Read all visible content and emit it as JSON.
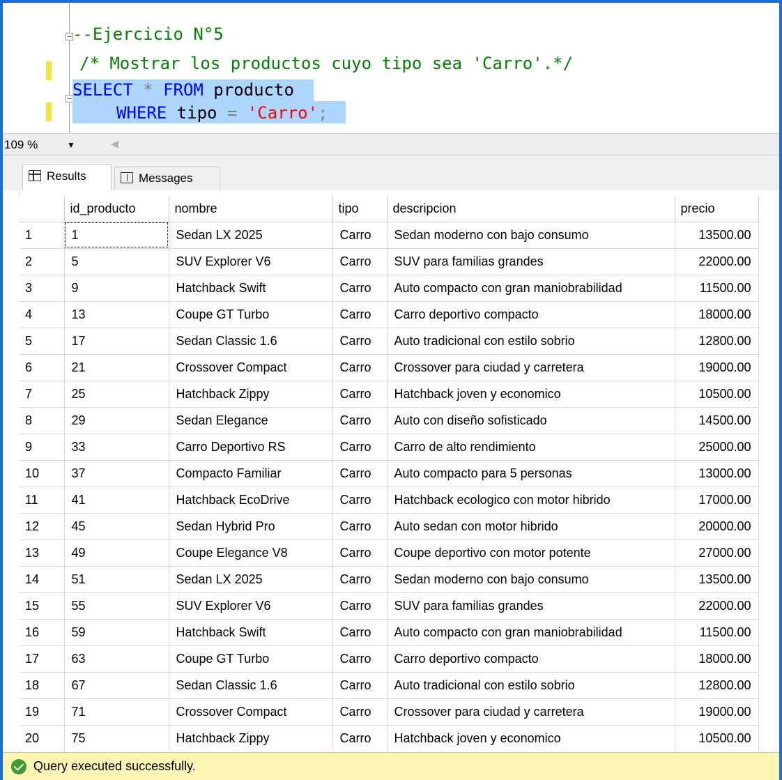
{
  "editor": {
    "lines": [
      {
        "comment": "--Ejercicio N°5"
      },
      {
        "comment": "/* Mostrar los productos cuyo tipo sea 'Carro'.*/"
      },
      {
        "kw1": "SELECT",
        "op": " * ",
        "kw2": "FROM",
        "ident": " producto"
      },
      {
        "kw1": "WHERE",
        "ident": " tipo ",
        "op": "=",
        "str": "'Carro'",
        "end": ";"
      }
    ]
  },
  "zoom": {
    "value": "109 %"
  },
  "tabs": {
    "results": "Results",
    "messages": "Messages"
  },
  "grid": {
    "columns": [
      "id_producto",
      "nombre",
      "tipo",
      "descripcion",
      "precio"
    ],
    "rows": [
      [
        "1",
        "1",
        "Sedan LX 2025",
        "Carro",
        "Sedan moderno con bajo consumo",
        "13500.00"
      ],
      [
        "2",
        "5",
        "SUV Explorer V6",
        "Carro",
        "SUV para familias grandes",
        "22000.00"
      ],
      [
        "3",
        "9",
        "Hatchback Swift",
        "Carro",
        "Auto compacto con gran maniobrabilidad",
        "11500.00"
      ],
      [
        "4",
        "13",
        "Coupe GT Turbo",
        "Carro",
        "Carro deportivo compacto",
        "18000.00"
      ],
      [
        "5",
        "17",
        "Sedan Classic 1.6",
        "Carro",
        "Auto tradicional con estilo sobrio",
        "12800.00"
      ],
      [
        "6",
        "21",
        "Crossover Compact",
        "Carro",
        "Crossover para ciudad y carretera",
        "19000.00"
      ],
      [
        "7",
        "25",
        "Hatchback Zippy",
        "Carro",
        "Hatchback joven y economico",
        "10500.00"
      ],
      [
        "8",
        "29",
        "Sedan Elegance",
        "Carro",
        "Auto con diseño sofisticado",
        "14500.00"
      ],
      [
        "9",
        "33",
        "Carro Deportivo RS",
        "Carro",
        "Carro de alto rendimiento",
        "25000.00"
      ],
      [
        "10",
        "37",
        "Compacto Familiar",
        "Carro",
        "Auto compacto para 5 personas",
        "13000.00"
      ],
      [
        "11",
        "41",
        "Hatchback EcoDrive",
        "Carro",
        "Hatchback ecologico con motor hibrido",
        "17000.00"
      ],
      [
        "12",
        "45",
        "Sedan Hybrid Pro",
        "Carro",
        "Auto sedan con motor hibrido",
        "20000.00"
      ],
      [
        "13",
        "49",
        "Coupe Elegance V8",
        "Carro",
        "Coupe deportivo con motor potente",
        "27000.00"
      ],
      [
        "14",
        "51",
        "Sedan LX 2025",
        "Carro",
        "Sedan moderno con bajo consumo",
        "13500.00"
      ],
      [
        "15",
        "55",
        "SUV Explorer V6",
        "Carro",
        "SUV para familias grandes",
        "22000.00"
      ],
      [
        "16",
        "59",
        "Hatchback Swift",
        "Carro",
        "Auto compacto con gran maniobrabilidad",
        "11500.00"
      ],
      [
        "17",
        "63",
        "Coupe GT Turbo",
        "Carro",
        "Carro deportivo compacto",
        "18000.00"
      ],
      [
        "18",
        "67",
        "Sedan Classic 1.6",
        "Carro",
        "Auto tradicional con estilo sobrio",
        "12800.00"
      ],
      [
        "19",
        "71",
        "Crossover Compact",
        "Carro",
        "Crossover para ciudad y carretera",
        "19000.00"
      ],
      [
        "20",
        "75",
        "Hatchback Zippy",
        "Carro",
        "Hatchback joven y economico",
        "10500.00"
      ]
    ]
  },
  "status": {
    "text": "Query executed successfully."
  },
  "colors": {
    "frame": "#1c6ed6",
    "selection": "#add6ff",
    "status_bg": "#fdf5b3",
    "keyword": "#0000ff",
    "comment": "#008000",
    "string": "#ff0000"
  }
}
